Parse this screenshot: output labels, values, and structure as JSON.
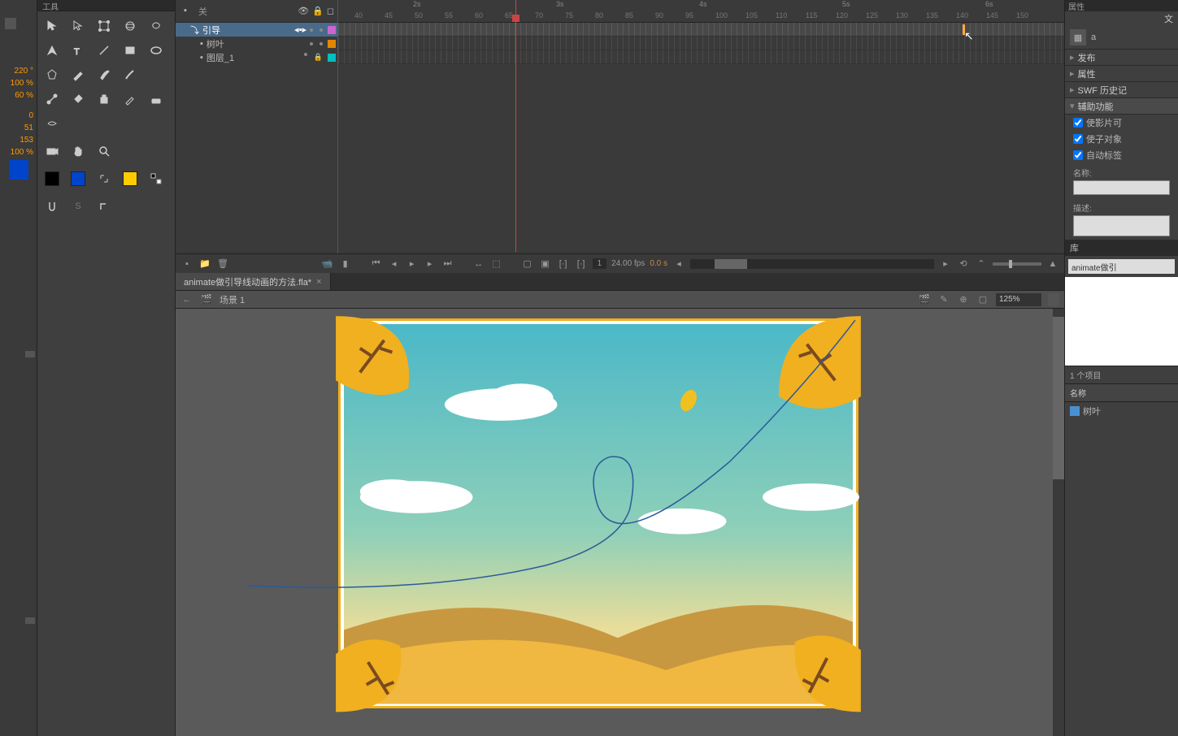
{
  "left_props": {
    "values": [
      "220 °",
      "100 %",
      "60 %",
      "0",
      "51",
      "153",
      "100 %"
    ]
  },
  "tools": {
    "title": "工具"
  },
  "layer_header": "关",
  "layers": [
    {
      "name": "引导",
      "active": true,
      "indent": false,
      "color": "#cc66cc"
    },
    {
      "name": "树叶",
      "active": false,
      "indent": true,
      "color": "#e08800"
    },
    {
      "name": "图层_1",
      "active": false,
      "indent": true,
      "color": "#00c0c0"
    }
  ],
  "time_seconds": [
    "2s",
    "3s",
    "4s",
    "5s",
    "6s"
  ],
  "frame_numbers": [
    "40",
    "45",
    "50",
    "55",
    "60",
    "65",
    "70",
    "75",
    "80",
    "85",
    "90",
    "95",
    "100",
    "105",
    "110",
    "115",
    "120",
    "125",
    "130",
    "135",
    "140",
    "145",
    "150"
  ],
  "timeline_footer": {
    "current_frame": "1",
    "fps": "24.00 fps",
    "time": "0.0 s"
  },
  "doc_tab": "animate做引导线动画的方法.fla*",
  "scene_name": "场景 1",
  "zoom": "125%",
  "right": {
    "title": "属性",
    "accordions": [
      "发布",
      "属性",
      "SWF 历史记",
      "辅助功能"
    ],
    "checkboxes": [
      "使影片可",
      "使子对象",
      "自动标签"
    ],
    "name_label": "名称:",
    "desc_label": "描述:",
    "lib_tab": "库",
    "lib_filename": "animate做引",
    "lib_count": "1 个项目",
    "lib_col": "名称",
    "lib_item": "树叶",
    "doc_letter": "a",
    "doc_word": "文"
  },
  "chart_data": null
}
